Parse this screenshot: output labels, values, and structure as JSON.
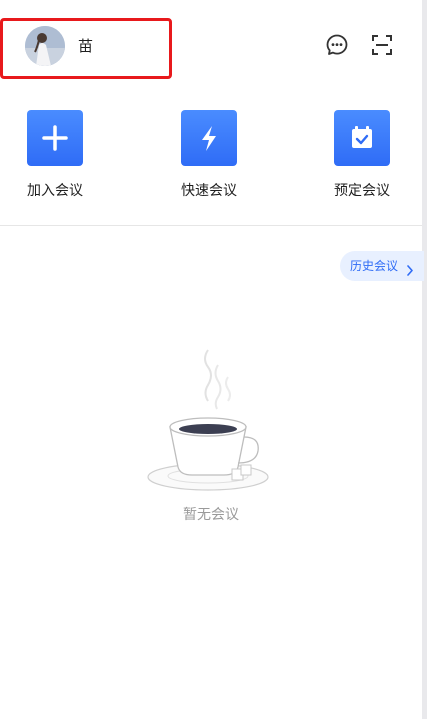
{
  "header": {
    "user_name": "苗",
    "avatar_icon": "user-avatar-photo",
    "message_icon": "chat-bubble-icon",
    "scan_icon": "scan-frame-icon"
  },
  "actions": [
    {
      "label": "加入会议",
      "icon": "plus-icon"
    },
    {
      "label": "快速会议",
      "icon": "lightning-icon"
    },
    {
      "label": "预定会议",
      "icon": "calendar-check-icon"
    }
  ],
  "history": {
    "label": "历史会议",
    "icon": "chevron-right-icon"
  },
  "empty_state": {
    "text": "暂无会议",
    "illustration": "coffee-cup-illustration"
  },
  "colors": {
    "accent": "#2f6cf6",
    "highlight_border": "#e8191c",
    "chip_bg": "#e8f0ff",
    "muted_text": "#9a9a9a"
  }
}
